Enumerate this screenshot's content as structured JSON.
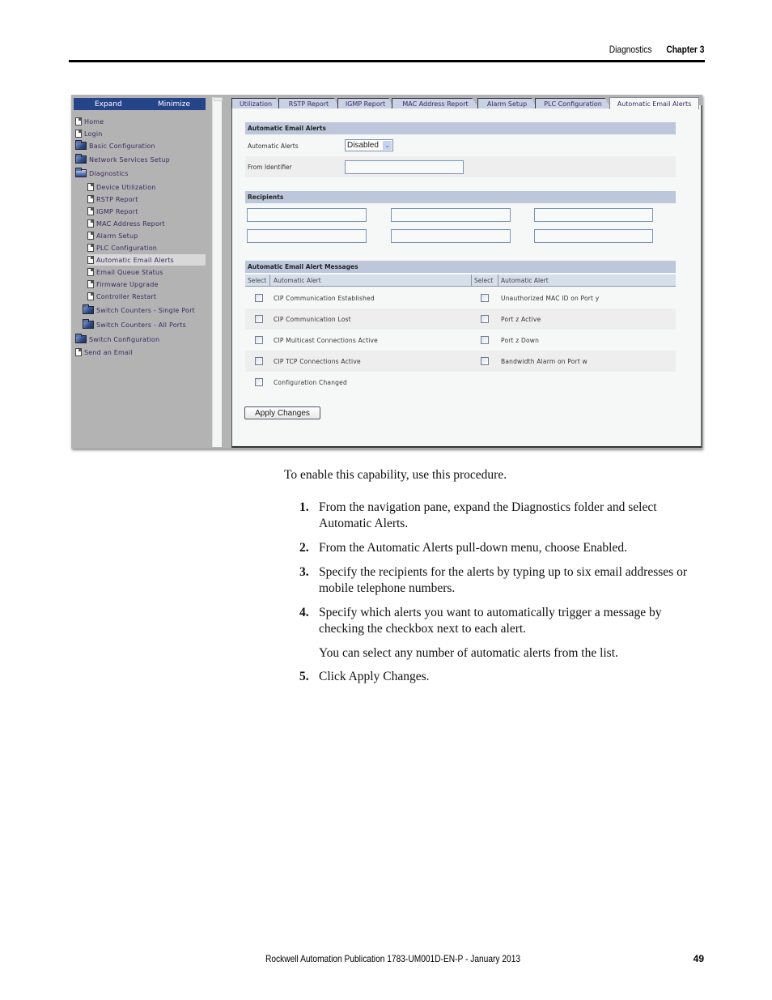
{
  "running_header": {
    "section": "Diagnostics",
    "chapter": "Chapter 3"
  },
  "screenshot": {
    "sidebar": {
      "expand_label": "Expand",
      "minimize_label": "Minimize",
      "items": [
        {
          "label": "Home",
          "icon": "page-icon",
          "level": 0
        },
        {
          "label": "Login",
          "icon": "page-icon",
          "level": 0
        },
        {
          "label": "Basic Configuration",
          "icon": "folder-icon",
          "level": 0
        },
        {
          "label": "Network Services Setup",
          "icon": "folder-icon",
          "level": 0
        },
        {
          "label": "Diagnostics",
          "icon": "folder-open-icon",
          "level": 0
        },
        {
          "label": "Device Utilization",
          "icon": "page-icon",
          "level": 2
        },
        {
          "label": "RSTP Report",
          "icon": "page-icon",
          "level": 2
        },
        {
          "label": "IGMP Report",
          "icon": "page-icon",
          "level": 2
        },
        {
          "label": "MAC Address Report",
          "icon": "page-icon",
          "level": 2
        },
        {
          "label": "Alarm Setup",
          "icon": "page-icon",
          "level": 2
        },
        {
          "label": "PLC Configuration",
          "icon": "page-icon",
          "level": 2
        },
        {
          "label": "Automatic Email Alerts",
          "icon": "page-icon",
          "level": 2,
          "selected": true
        },
        {
          "label": "Email Queue Status",
          "icon": "page-icon",
          "level": 2
        },
        {
          "label": "Firmware Upgrade",
          "icon": "page-icon",
          "level": 2
        },
        {
          "label": "Controller Restart",
          "icon": "page-icon",
          "level": 2
        },
        {
          "label": "Switch Counters - Single Port",
          "icon": "folder-icon",
          "level": 1
        },
        {
          "label": "Switch Counters - All Ports",
          "icon": "folder-icon",
          "level": 1
        },
        {
          "label": "Switch Configuration",
          "icon": "folder-icon",
          "level": 0
        },
        {
          "label": "Send an Email",
          "icon": "page-icon",
          "level": 0
        }
      ]
    },
    "tabs": [
      {
        "label": "Utilization"
      },
      {
        "label": "RSTP Report"
      },
      {
        "label": "IGMP Report"
      },
      {
        "label": "MAC Address Report"
      },
      {
        "label": "Alarm Setup"
      },
      {
        "label": "PLC Configuration"
      },
      {
        "label": "Automatic Email Alerts",
        "active": true
      }
    ],
    "alerts_section": {
      "title": "Automatic Email Alerts",
      "automatic_alerts_label": "Automatic Alerts",
      "automatic_alerts_value": "Disabled",
      "from_identifier_label": "From Identifier",
      "from_identifier_value": ""
    },
    "recipients_section": {
      "title": "Recipients",
      "recipients": [
        "",
        "",
        "",
        "",
        "",
        ""
      ]
    },
    "messages_section": {
      "title": "Automatic Email Alert Messages",
      "col_select": "Select",
      "col_alert": "Automatic Alert",
      "left_alerts": [
        {
          "label": "CIP Communication Established",
          "checked": false
        },
        {
          "label": "CIP Communication Lost",
          "checked": false
        },
        {
          "label": "CIP Multicast Connections Active",
          "checked": false
        },
        {
          "label": "CIP TCP Connections Active",
          "checked": false
        },
        {
          "label": "Configuration Changed",
          "checked": false
        }
      ],
      "right_alerts": [
        {
          "label": "Unauthorized MAC ID on Port y",
          "checked": false
        },
        {
          "label": "Port z Active",
          "checked": false
        },
        {
          "label": "Port z Down",
          "checked": false
        },
        {
          "label": "Bandwidth Alarm on Port w",
          "checked": false
        }
      ]
    },
    "apply_label": "Apply Changes"
  },
  "body": {
    "intro": "To enable this capability, use this procedure.",
    "steps": [
      {
        "num": "1.",
        "text": "From the navigation pane, expand the Diagnostics folder and select Automatic Alerts."
      },
      {
        "num": "2.",
        "text": "From the Automatic Alerts pull-down menu, choose Enabled."
      },
      {
        "num": "3.",
        "text": "Specify the recipients for the alerts by typing up to six email addresses or mobile telephone numbers."
      },
      {
        "num": "4.",
        "text": "Specify which alerts you want to automatically trigger a message by checking the checkbox next to each alert."
      },
      {
        "num": "5.",
        "text": "Click Apply Changes."
      }
    ],
    "step4_note": "You can select any number of automatic alerts from the list."
  },
  "footer": {
    "publication": "Rockwell Automation Publication 1783-UM001D-EN-P - January 2013",
    "page": "49"
  }
}
